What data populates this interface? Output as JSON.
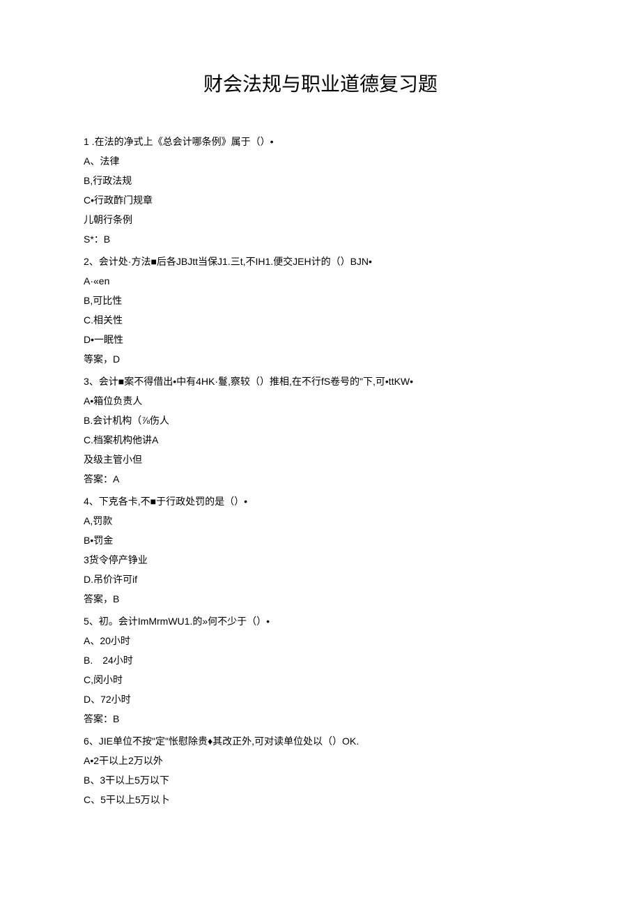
{
  "title": "财会法规与职业道德复习题",
  "questions": [
    {
      "stem": "1 .在法的净式上《总会计哪条例》属于（）•",
      "options": [
        "A、法律",
        "B,行政法规",
        "C•行政酢门规章",
        "儿朝行条例"
      ],
      "answer": "S*：B"
    },
    {
      "stem": "2、会计处·方法■后各JBJtt当保J1.三t,不IH1.便交JEH计的（）BJN•",
      "options": [
        "A·«en",
        "B,可比性",
        "C.相关性",
        "D•一眠性"
      ],
      "answer": "等案，D"
    },
    {
      "stem": "3、会计■案不得借出•中有4HK·鬘,察较（）推相,在不行fS卷号的\"下,可•ttKW•",
      "options": [
        "A•箱位负责人",
        "B.会计机构（⅞伤人",
        "C.档案机构他讲A",
        "及级主管小但"
      ],
      "answer": "答案：A"
    },
    {
      "stem": "4、下克各卡,不■于行政处罚的是（）•",
      "options": [
        "A,罚款",
        "B•罚金",
        "3货令停产铮业",
        "D.吊价许可if"
      ],
      "answer": "答案，B"
    },
    {
      "stem": "5、初。会计ImMrmWU1.的»何不少于（）•",
      "options": [
        "A、20小时",
        "B.　24小时",
        "C,闵小时",
        "D、72小时"
      ],
      "answer": "答案：B"
    },
    {
      "stem": "6、JIE单位不按\"定\"怅慰除贵♦其改正外,可对读单位处以（）OK.",
      "options": [
        "A•2干以上2万以外",
        "B、3干以上5万以下",
        "C、5干以上5万以卜"
      ],
      "answer": ""
    }
  ]
}
